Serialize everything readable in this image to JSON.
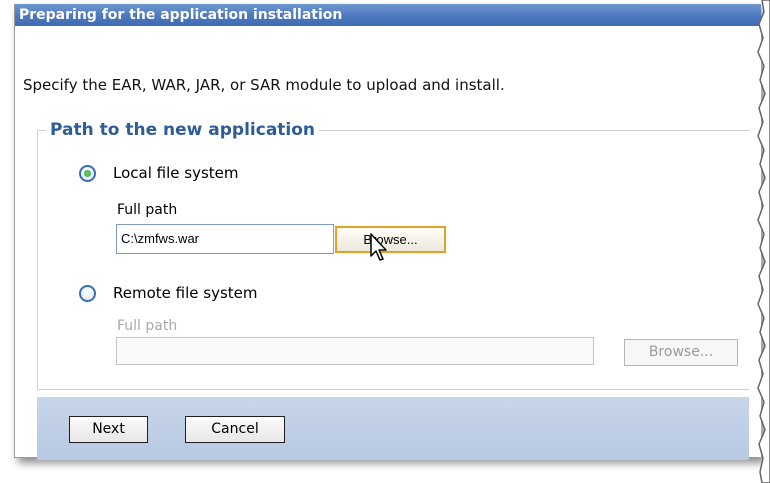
{
  "window": {
    "title": "Preparing for the application installation"
  },
  "intro_text": "Specify the EAR, WAR, JAR, or SAR module to upload and install.",
  "group": {
    "legend": "Path to the new application",
    "local": {
      "label": "Local file system",
      "selected": true,
      "full_path_label": "Full path",
      "full_path_value": "C:\\zmfws.war",
      "browse_label": "Browse..."
    },
    "remote": {
      "label": "Remote file system",
      "selected": false,
      "full_path_label": "Full path",
      "full_path_value": "",
      "browse_label": "Browse..."
    }
  },
  "buttons": {
    "next": "Next",
    "cancel": "Cancel"
  },
  "colors": {
    "titlebar": "#4d78be",
    "legend": "#2d5c97",
    "button_bar": "#c0cfe6",
    "focus_border": "#e6a124"
  },
  "icons": {
    "cursor": "arrow-cursor-icon"
  }
}
